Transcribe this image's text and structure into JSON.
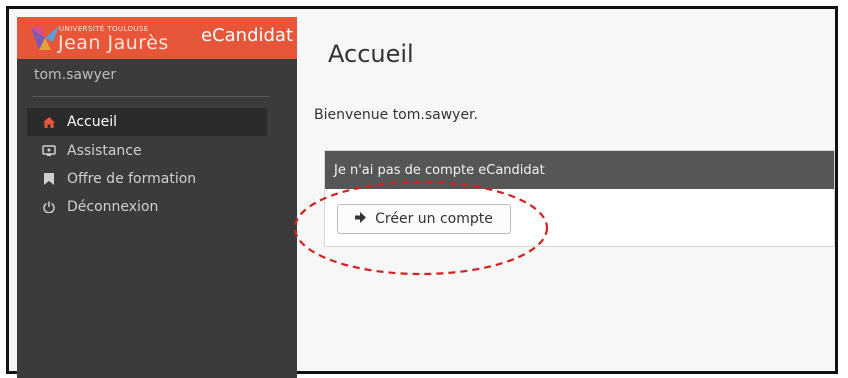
{
  "brand": {
    "university_top": "UNIVERSITÉ TOULOUSE",
    "university_name": "Jean Jaurès",
    "app_name": "eCandidat",
    "accent_color": "#e8563a"
  },
  "sidebar": {
    "username": "tom.sawyer",
    "items": [
      {
        "label": "Accueil",
        "icon": "home-icon",
        "active": true
      },
      {
        "label": "Assistance",
        "icon": "support-icon",
        "active": false
      },
      {
        "label": "Offre de formation",
        "icon": "bookmark-icon",
        "active": false
      },
      {
        "label": "Déconnexion",
        "icon": "power-icon",
        "active": false
      }
    ]
  },
  "main": {
    "title": "Accueil",
    "welcome": "Bienvenue tom.sawyer.",
    "panel": {
      "header": "Je n'ai pas de compte eCandidat",
      "button_label": "Créer un compte",
      "button_icon": "sign-in-icon"
    }
  },
  "annotation": {
    "shape": "dashed-ellipse",
    "color": "#d42020"
  }
}
